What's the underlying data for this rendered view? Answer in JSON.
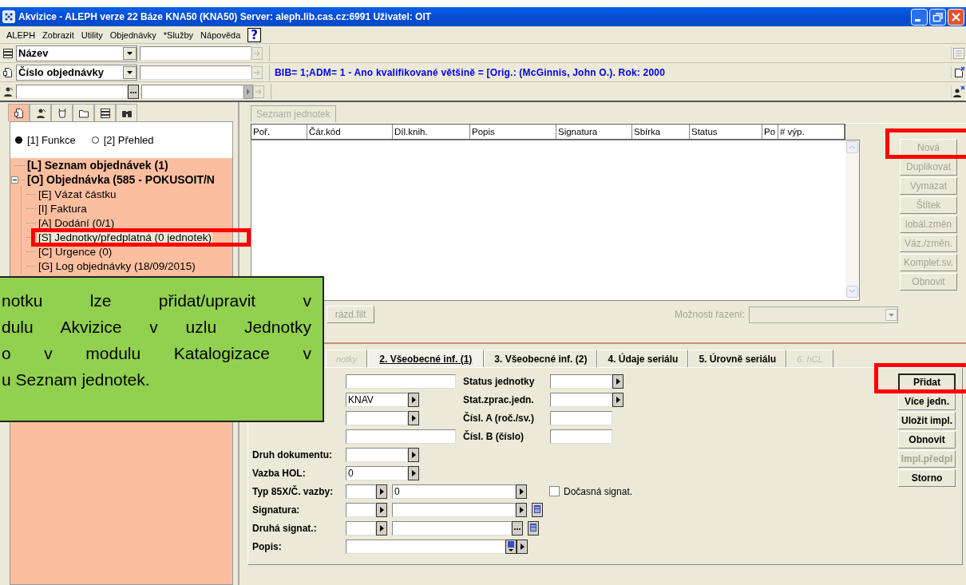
{
  "window": {
    "title": "Akvizice - ALEPH verze 22  Báze KNA50 (KNA50)  Server: aleph.lib.cas.cz:6991  Uživatel: OIT"
  },
  "menu": [
    "ALEPH",
    "Zobrazit",
    "Utility",
    "Objednávky",
    "*Služby",
    "Nápověda"
  ],
  "help_button": "?",
  "search_rows": [
    {
      "kind": "field_select",
      "select": "Název"
    },
    {
      "kind": "field_select",
      "select": "Číslo objednávky",
      "info": "BIB= 1;ADM= 1 - Ano kvalifikované většině = [Orig.: (McGinnis, John O.). Rok: 2000"
    },
    {
      "kind": "browse"
    }
  ],
  "left_panel": {
    "tabs": [
      {
        "selected": true
      },
      {
        "selected": false
      },
      {
        "selected": false
      },
      {
        "selected": false
      },
      {
        "selected": false
      },
      {
        "selected": false
      }
    ],
    "view_options": [
      {
        "label": "[1] Funkce",
        "selected": true
      },
      {
        "label": "[2] Přehled",
        "selected": false
      }
    ],
    "tree": [
      {
        "label": "[L] Seznam objednávek (1)",
        "selected": false
      },
      {
        "label": "[O] Objednávka (585 - POKUSOIT/N",
        "selected": false,
        "expanded": true,
        "children": [
          {
            "label": "[E] Vázat částku",
            "selected": false
          },
          {
            "label": "[I] Faktura",
            "selected": false
          },
          {
            "label": "[A] Dodání (0/1)",
            "selected": false
          },
          {
            "label": "[S] Jednotky/předplatná (0 jednotek)",
            "selected": true,
            "highlighted": true
          },
          {
            "label": "[C] Urgence (0)",
            "selected": false
          },
          {
            "label": "[G] Log objednávky (18/09/2015)",
            "selected": false
          }
        ]
      }
    ]
  },
  "units_list": {
    "tab": {
      "label": "Seznam jednotek",
      "disabled": true
    },
    "columns": [
      "Poř.",
      "Čár.kód",
      "Díl.knih.",
      "Popis",
      "Signatura",
      "Sbírka",
      "Status",
      "Po",
      "# výp."
    ],
    "filter_button": {
      "label": "rázd.filt",
      "disabled": true
    },
    "sort": {
      "label": "Možnosti řazení:",
      "disabled": true
    },
    "buttons": [
      {
        "label": "Nová",
        "disabled": true,
        "highlighted": true
      },
      {
        "label": "Duplikovat",
        "disabled": true
      },
      {
        "label": "Vymazat",
        "disabled": true
      },
      {
        "label": "Štítek",
        "disabled": true
      },
      {
        "label": "lobál.změn",
        "disabled": true
      },
      {
        "label": "Váz./změn.",
        "disabled": true
      },
      {
        "label": "Komplet.sv.",
        "disabled": true
      },
      {
        "label": "Obnovit",
        "disabled": true
      }
    ]
  },
  "detail_tabs": [
    {
      "label": "notky",
      "selected": false,
      "disabled": true
    },
    {
      "label": "2. Všeobecné inf. (1)",
      "selected": true,
      "disabled": false
    },
    {
      "label": "3. Všeobecné inf. (2)",
      "selected": false,
      "disabled": false
    },
    {
      "label": "4. Údaje seriálu",
      "selected": false,
      "disabled": false
    },
    {
      "label": "5. Úrovně seriálu",
      "selected": false,
      "disabled": false
    },
    {
      "label": "6. hCL",
      "selected": false,
      "disabled": true
    }
  ],
  "form": [
    {
      "controls": [
        {
          "kind": "text"
        }
      ],
      "side": {
        "label": "Status jednotky",
        "control": {
          "kind": "picker"
        }
      }
    },
    {
      "controls": [
        {
          "kind": "picker",
          "value": "KNAV"
        }
      ],
      "side": {
        "label": "Stat.zprac.jedn.",
        "control": {
          "kind": "picker"
        }
      }
    },
    {
      "controls": [
        {
          "kind": "picker"
        }
      ],
      "side": {
        "label": "Čísl. A (roč./sv.)",
        "control": {
          "kind": "side_text"
        }
      }
    },
    {
      "controls": [
        {
          "kind": "text"
        }
      ],
      "side": {
        "label": "Čísl. B (číslo)",
        "control": {
          "kind": "side_text"
        }
      }
    },
    {
      "label": "Druh dokumentu:",
      "controls": [
        {
          "kind": "picker"
        }
      ]
    },
    {
      "label": "Vazba HOL:",
      "controls": [
        {
          "kind": "picker",
          "value": "0"
        }
      ]
    },
    {
      "label": "Typ 85X/Č. vazby:",
      "controls": [
        {
          "kind": "short_picker"
        },
        {
          "kind": "wide_picker",
          "value": "0"
        },
        {
          "kind": "checkbox",
          "label": "Dočasná signat.",
          "checked": false
        }
      ]
    },
    {
      "label": "Signatura:",
      "controls": [
        {
          "kind": "short_picker"
        },
        {
          "kind": "wide_picker"
        },
        {
          "kind": "list"
        }
      ]
    },
    {
      "label": "Druhá signat.:",
      "controls": [
        {
          "kind": "short_picker"
        },
        {
          "kind": "browse"
        },
        {
          "kind": "list"
        }
      ]
    },
    {
      "label": "Popis:",
      "controls": [
        {
          "kind": "memo"
        }
      ]
    }
  ],
  "detail_buttons": [
    {
      "label": "Přidat",
      "disabled": false,
      "default": true,
      "highlighted": true
    },
    {
      "label": "Více jedn.",
      "disabled": false,
      "default": false
    },
    {
      "label": "Uložit impl.",
      "disabled": false,
      "default": false
    },
    {
      "label": "Obnovit",
      "disabled": false,
      "default": false
    },
    {
      "label": "Impl.předpl",
      "disabled": true,
      "default": false
    },
    {
      "label": "Storno",
      "disabled": false,
      "default": false
    }
  ],
  "callout": {
    "lines": [
      "notku lze přidat/upravit v",
      "dulu Akvizice v uzlu Jednotky",
      "o v modulu Katalogizace v",
      "u Seznam jednotek."
    ]
  }
}
